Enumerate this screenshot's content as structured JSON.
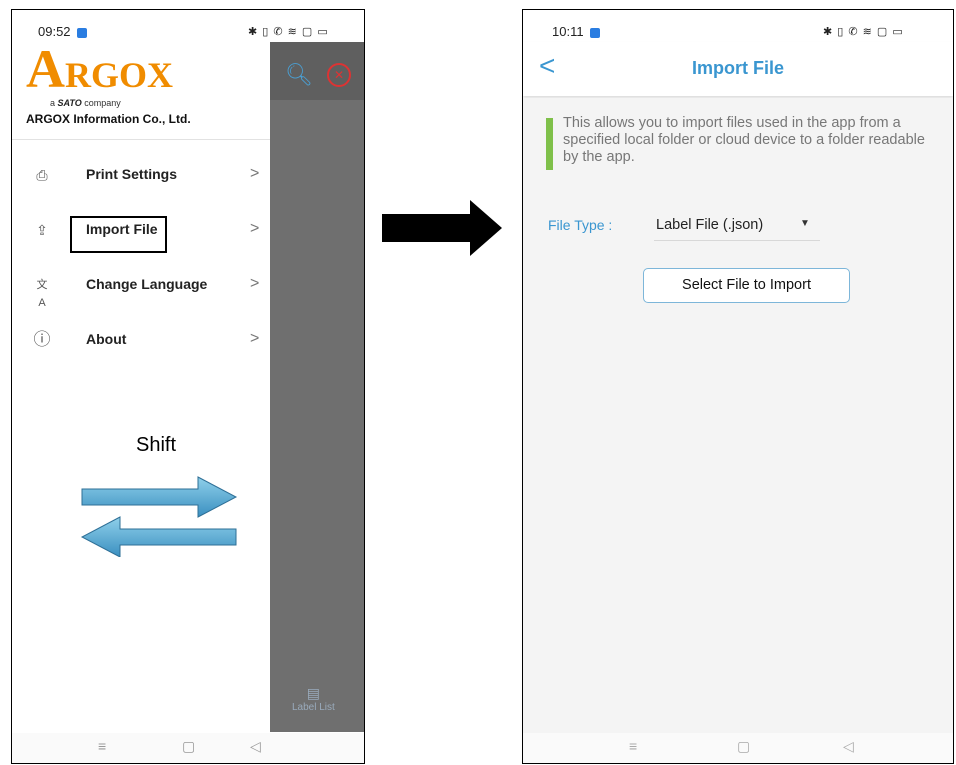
{
  "left_phone": {
    "status_time": "09:52",
    "status_icons": "✱ ▯ ✆ ≋ ▢ ▭",
    "logo_a": "A",
    "logo_rest": "RGOX",
    "tagline_prefix": "a",
    "tagline_brand": "SATO",
    "tagline_suffix": "company",
    "company_name": "ARGOX Information Co., Ltd.",
    "menu": [
      {
        "label": "Print Settings",
        "icon": "settings-doc-icon",
        "glyph": "⎙"
      },
      {
        "label": "Import File",
        "icon": "import-file-icon",
        "glyph": "⇪"
      },
      {
        "label": "Change Language",
        "icon": "translate-icon",
        "glyph": "文A"
      },
      {
        "label": "About",
        "icon": "info-icon",
        "glyph": "ⓘ"
      }
    ],
    "chevron": ">",
    "shift_label": "Shift",
    "label_list": "Label List",
    "label_list_icon": "▤",
    "nav": {
      "menu": "≡",
      "home": "▢",
      "back": "◁"
    }
  },
  "right_phone": {
    "status_time": "10:11",
    "status_icons": "✱ ▯ ✆ ≋ ▢ ▭",
    "back": "<",
    "title": "Import File",
    "note": "This allows you to import files used in the app from a specified local folder or cloud device to a folder readable by the app.",
    "file_type_label": "File Type :",
    "file_type_value": "Label File (.json)",
    "caret": "▼",
    "select_button": "Select File to Import",
    "nav": {
      "menu": "≡",
      "home": "▢",
      "back": "◁"
    }
  },
  "colors": {
    "accent": "#3a96d0",
    "brand_orange": "#f08c00",
    "note_bar": "#7fc04a",
    "overlay": "#6f6f6f"
  }
}
